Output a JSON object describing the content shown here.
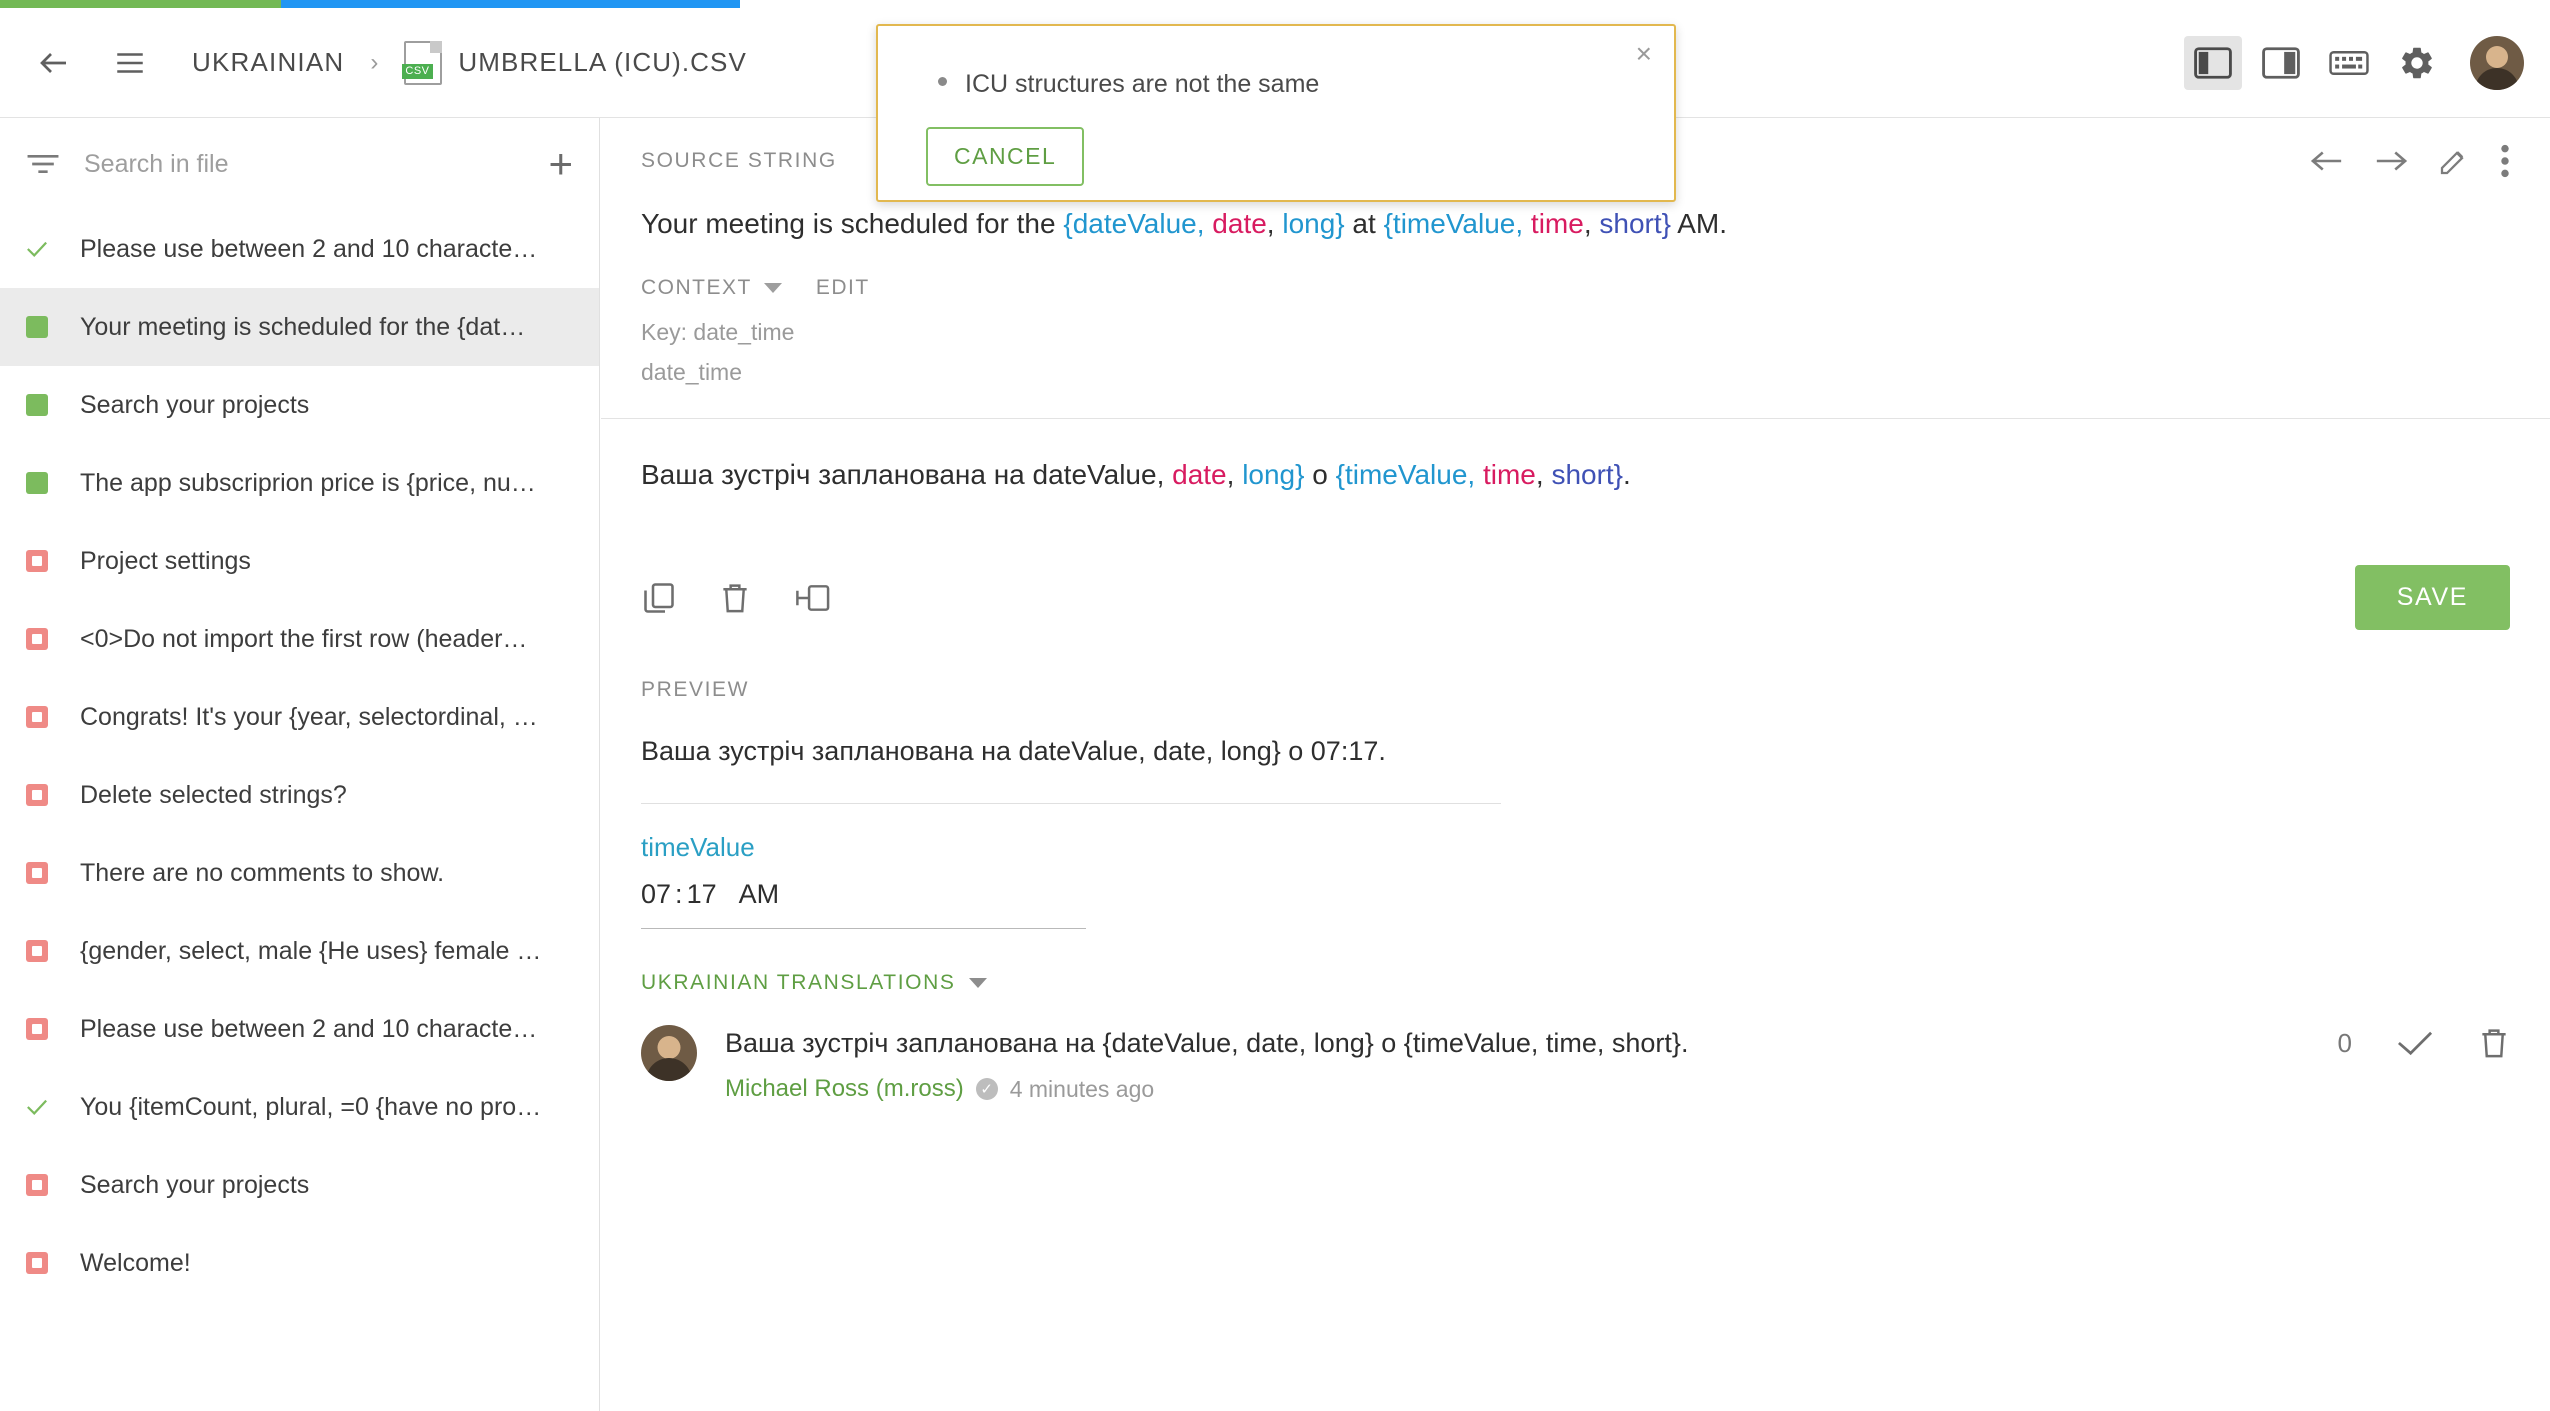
{
  "progress": {
    "green_pct": 11,
    "blue_pct": 18
  },
  "topbar": {
    "language": "UKRAINIAN",
    "file_name": "UMBRELLA (ICU).CSV",
    "file_badge": "CSV",
    "separator": "›"
  },
  "sidebar": {
    "search": {
      "placeholder": "Search in file",
      "value": ""
    },
    "add_label": "+",
    "items": [
      {
        "status": "check",
        "text": "Please use between 2 and 10 characte…",
        "selected": false
      },
      {
        "status": "green",
        "text": "Your meeting is scheduled for the {dat…",
        "selected": true
      },
      {
        "status": "green",
        "text": "Search your projects",
        "selected": false
      },
      {
        "status": "green",
        "text": "The app subscriprion price is {price, nu…",
        "selected": false
      },
      {
        "status": "red",
        "text": "Project settings",
        "selected": false
      },
      {
        "status": "red",
        "text": "<0>Do not import the first row (header…",
        "selected": false
      },
      {
        "status": "red",
        "text": "Congrats! It's your {year, selectordinal, …",
        "selected": false
      },
      {
        "status": "red",
        "text": "Delete selected strings?",
        "selected": false
      },
      {
        "status": "red",
        "text": "There are no comments to show.",
        "selected": false
      },
      {
        "status": "red",
        "text": "{gender, select, male {He uses} female …",
        "selected": false
      },
      {
        "status": "red",
        "text": "Please use between 2 and 10 characte…",
        "selected": false
      },
      {
        "status": "check",
        "text": "You {itemCount, plural, =0 {have no pro…",
        "selected": false
      },
      {
        "status": "red",
        "text": "Search your projects",
        "selected": false
      },
      {
        "status": "red",
        "text": "Welcome!",
        "selected": false
      }
    ]
  },
  "toast": {
    "message": "ICU structures are not the same",
    "cancel_label": "CANCEL",
    "close_label": "×",
    "border_color": "#e2b84f"
  },
  "main": {
    "source_section_label": "SOURCE STRING",
    "source_parts": [
      {
        "t": "Your meeting is scheduled for the ",
        "c": "plain"
      },
      {
        "t": "{dateValue, ",
        "c": "blue"
      },
      {
        "t": "date",
        "c": "pink"
      },
      {
        "t": ", ",
        "c": "plain"
      },
      {
        "t": "long}",
        "c": "blue"
      },
      {
        "t": " at ",
        "c": "plain"
      },
      {
        "t": "{timeValue, ",
        "c": "blue"
      },
      {
        "t": "time",
        "c": "pink"
      },
      {
        "t": ", ",
        "c": "plain"
      },
      {
        "t": "short}",
        "c": "indigo"
      },
      {
        "t": " AM.",
        "c": "plain"
      }
    ],
    "context_label": "CONTEXT",
    "edit_label": "EDIT",
    "context_key_line": "Key: date_time",
    "context_second_line": "date_time",
    "translation_parts": [
      {
        "t": "Ваша зустріч запланована на dateValue, ",
        "c": "plain"
      },
      {
        "t": "date",
        "c": "pink"
      },
      {
        "t": ", ",
        "c": "plain"
      },
      {
        "t": "long}",
        "c": "blue"
      },
      {
        "t": " о ",
        "c": "plain"
      },
      {
        "t": "{timeValue, ",
        "c": "blue"
      },
      {
        "t": "time",
        "c": "pink"
      },
      {
        "t": ", ",
        "c": "plain"
      },
      {
        "t": "short}",
        "c": "indigo"
      },
      {
        "t": ".",
        "c": "plain"
      }
    ],
    "save_label": "SAVE",
    "preview_label": "PREVIEW",
    "preview_text": "Ваша зустріч запланована на dateValue, date, long} о 07:17.",
    "field_label": "timeValue",
    "time_hour": "07",
    "time_colon": ":",
    "time_minute": "17",
    "time_ampm": "AM",
    "translations_label": "UKRAINIAN TRANSLATIONS",
    "translation_entry": {
      "text": "Ваша зустріч запланована на {dateValue, date, long} о {timeValue, time, short}.",
      "author": "Michael Ross (m.ross)",
      "time_ago": "4 minutes ago",
      "votes": "0"
    }
  },
  "colors": {
    "green": "#82bf63",
    "blue": "#2196f3",
    "warning": "#e2b84f",
    "placeholder_blue": "#2196cf",
    "placeholder_pink": "#d81b60",
    "placeholder_indigo": "#3f51b5"
  }
}
